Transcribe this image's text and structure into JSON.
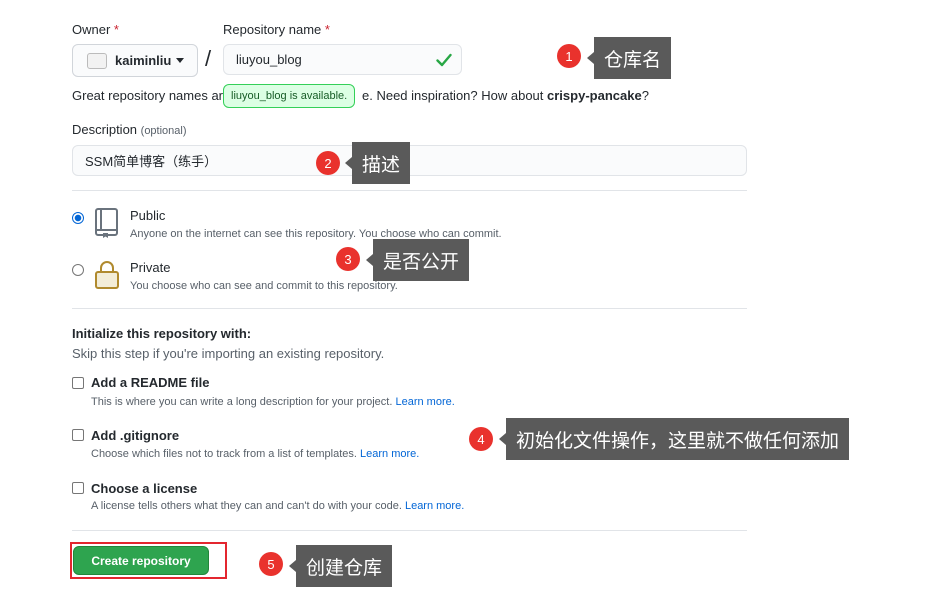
{
  "form": {
    "owner_label": "Owner",
    "repo_label": "Repository name",
    "required_mark": "*",
    "owner_value": "kaiminliu",
    "avatar_alt": "©",
    "separator": "/",
    "repo_value": "liuyou_blog",
    "availability_tooltip": "liuyou_blog is available.",
    "hint_prefix": "Great repository names ar",
    "hint_suffix": "e. Need inspiration? How about ",
    "hint_suggestion": "crispy-pancake",
    "hint_end": "?",
    "description_label": "Description",
    "description_optional": "(optional)",
    "description_value": "SSM简单博客（练手）"
  },
  "visibility": {
    "public": {
      "title": "Public",
      "desc": "Anyone on the internet can see this repository. You choose who can commit.",
      "selected": true
    },
    "private": {
      "title": "Private",
      "desc": "You choose who can see and commit to this repository.",
      "selected": false
    }
  },
  "init": {
    "heading": "Initialize this repository with:",
    "subheading": "Skip this step if you're importing an existing repository.",
    "readme": {
      "title": "Add a README file",
      "desc": "This is where you can write a long description for your project.",
      "link": "Learn more."
    },
    "gitignore": {
      "title": "Add .gitignore",
      "desc": "Choose which files not to track from a list of templates.",
      "link": "Learn more."
    },
    "license": {
      "title": "Choose a license",
      "desc": "A license tells others what they can and can't do with your code.",
      "link": "Learn more."
    }
  },
  "submit_label": "Create repository",
  "annotations": [
    {
      "number": "1",
      "text": "仓库名"
    },
    {
      "number": "2",
      "text": "描述"
    },
    {
      "number": "3",
      "text": "是否公开"
    },
    {
      "number": "4",
      "text": "初始化文件操作，这里就不做任何添加"
    },
    {
      "number": "5",
      "text": "创建仓库"
    }
  ],
  "colors": {
    "primary_button": "#2ea44f",
    "link": "#0366d6",
    "annotation_badge": "#e9322d",
    "annotation_box": "#5a5a5a",
    "highlight_frame": "#e3262f"
  },
  "icons": [
    "avatar",
    "caret-down-icon",
    "check-icon",
    "repo-icon",
    "lock-icon"
  ]
}
